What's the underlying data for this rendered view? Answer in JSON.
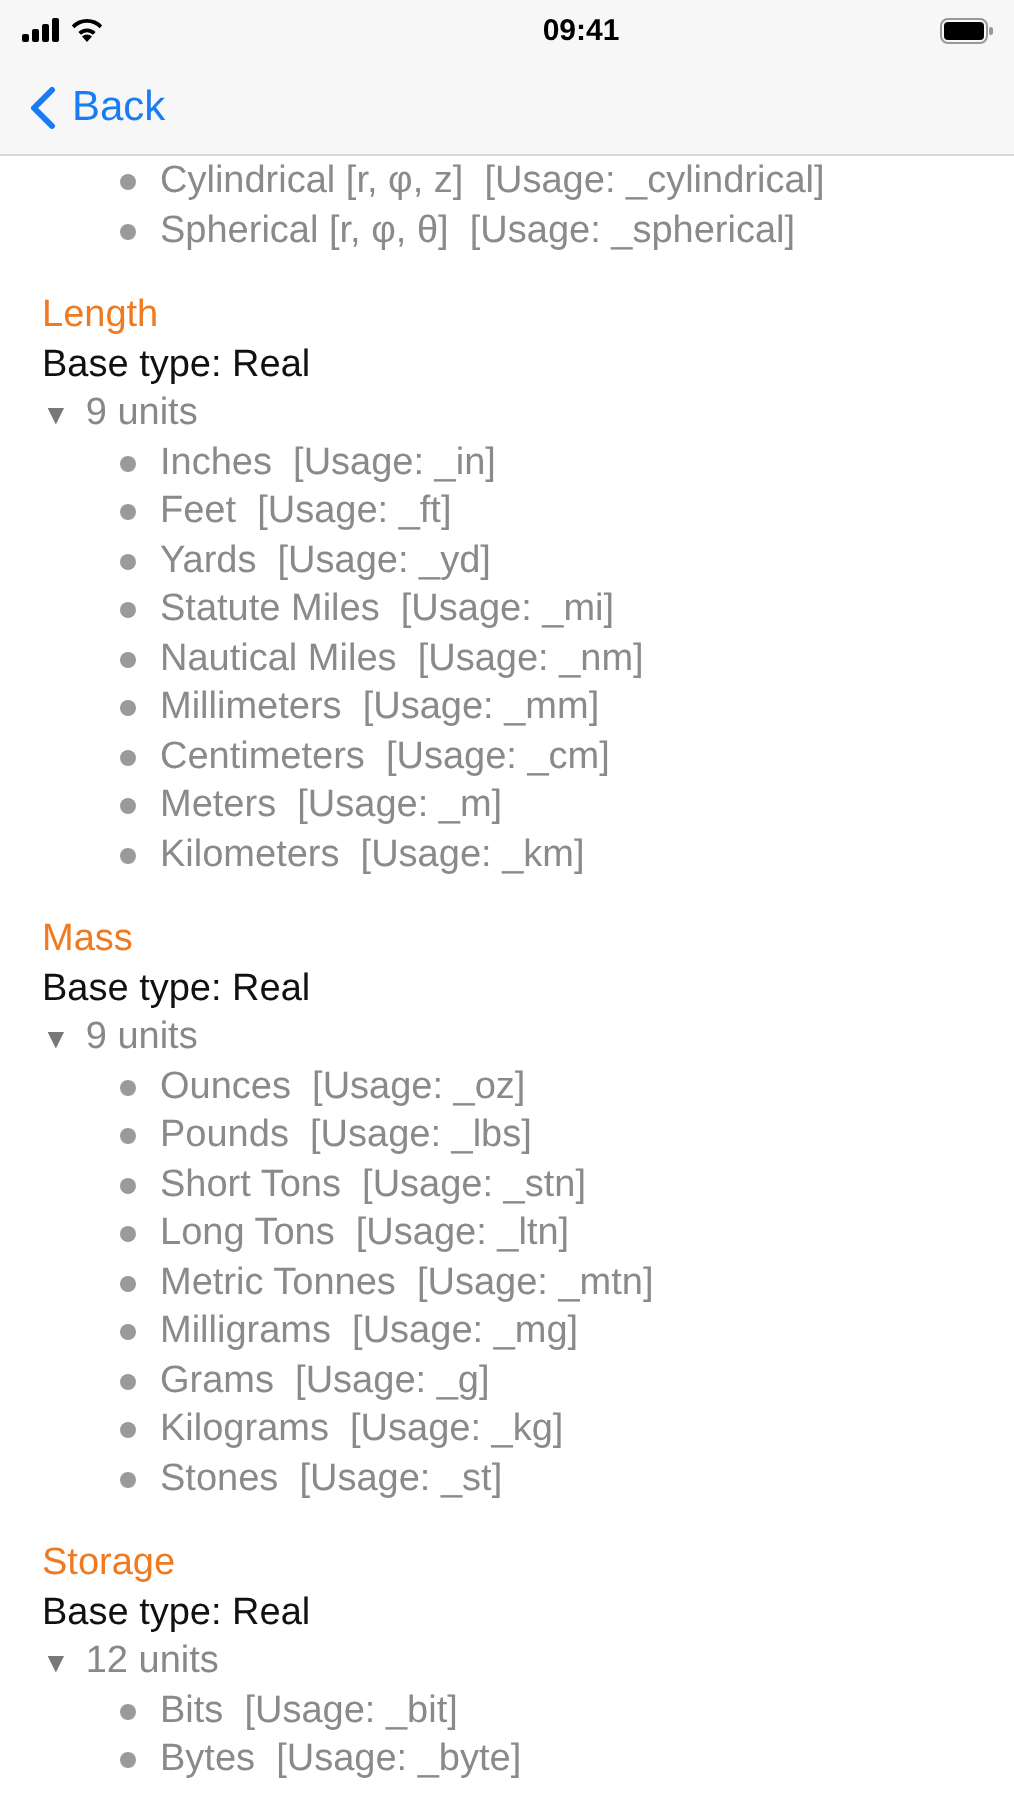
{
  "status_bar": {
    "time": "09:41"
  },
  "nav": {
    "back": "Back"
  },
  "sections": [
    {
      "units": [
        "Cylindrical [r, φ, z]  [Usage: _cylindrical]",
        "Spherical [r, φ, θ]  [Usage: _spherical]"
      ]
    },
    {
      "title": "Length",
      "base_type": "Base type: Real",
      "disclosure": "▼",
      "count": "9 units",
      "units": [
        "Inches  [Usage: _in]",
        "Feet  [Usage: _ft]",
        "Yards  [Usage: _yd]",
        "Statute Miles  [Usage: _mi]",
        "Nautical Miles  [Usage: _nm]",
        "Millimeters  [Usage: _mm]",
        "Centimeters  [Usage: _cm]",
        "Meters  [Usage: _m]",
        "Kilometers  [Usage: _km]"
      ]
    },
    {
      "title": "Mass",
      "base_type": "Base type: Real",
      "disclosure": "▼",
      "count": "9 units",
      "units": [
        "Ounces  [Usage: _oz]",
        "Pounds  [Usage: _lbs]",
        "Short Tons  [Usage: _stn]",
        "Long Tons  [Usage: _ltn]",
        "Metric Tonnes  [Usage: _mtn]",
        "Milligrams  [Usage: _mg]",
        "Grams  [Usage: _g]",
        "Kilograms  [Usage: _kg]",
        "Stones  [Usage: _st]"
      ]
    },
    {
      "title": "Storage",
      "base_type": "Base type: Real",
      "disclosure": "▼",
      "count": "12 units",
      "units": [
        "Bits  [Usage: _bit]",
        "Bytes  [Usage: _byte]"
      ]
    }
  ]
}
